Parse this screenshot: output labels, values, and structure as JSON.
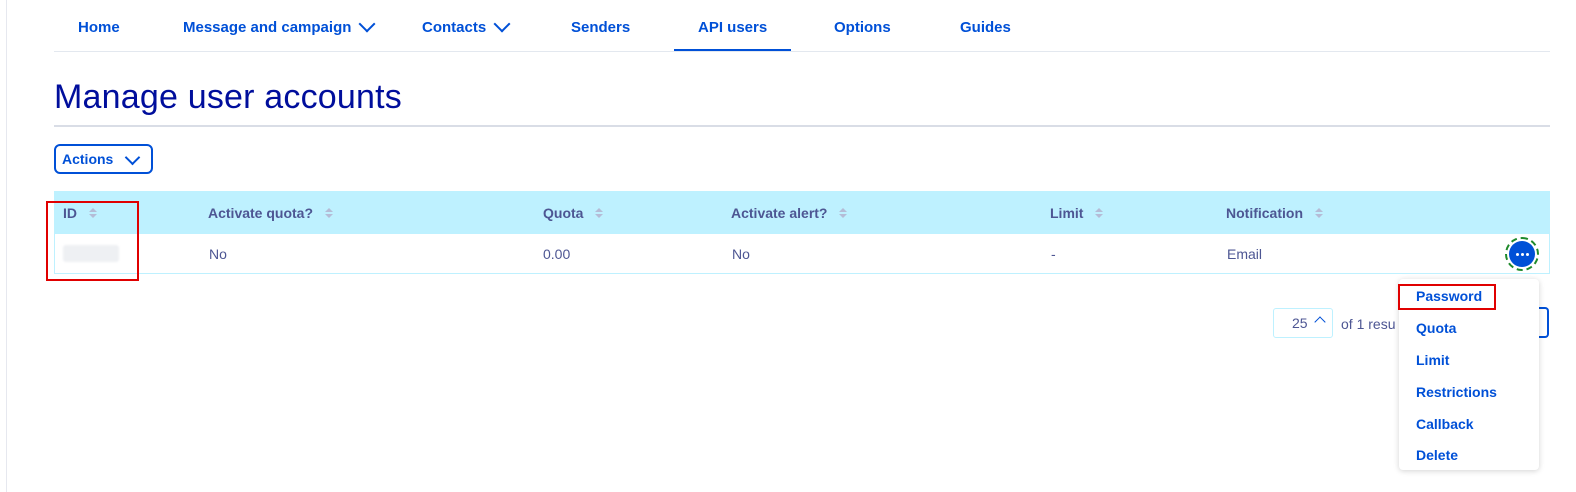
{
  "nav": {
    "items": [
      {
        "label": "Home"
      },
      {
        "label": "Message and campaign"
      },
      {
        "label": "Contacts"
      },
      {
        "label": "Senders"
      },
      {
        "label": "API users"
      },
      {
        "label": "Options"
      },
      {
        "label": "Guides"
      }
    ],
    "active": "API users"
  },
  "page": {
    "title": "Manage user accounts",
    "actions_label": "Actions"
  },
  "table": {
    "headers": [
      "ID",
      "Activate quota?",
      "Quota",
      "Activate alert?",
      "Limit",
      "Notification"
    ],
    "rows": [
      {
        "id": "",
        "activate_quota": "No",
        "quota": "0.00",
        "activate_alert": "No",
        "limit": "-",
        "notification": "Email"
      }
    ]
  },
  "pagination": {
    "page_size": "25",
    "results_text": "of 1 resu"
  },
  "row_menu": {
    "items": [
      "Password",
      "Quota",
      "Limit",
      "Restrictions",
      "Callback",
      "Delete"
    ]
  },
  "colors": {
    "accent": "#0050d7",
    "header_bg": "#bef1ff",
    "title": "#000e9c",
    "highlight": "#e00000"
  }
}
